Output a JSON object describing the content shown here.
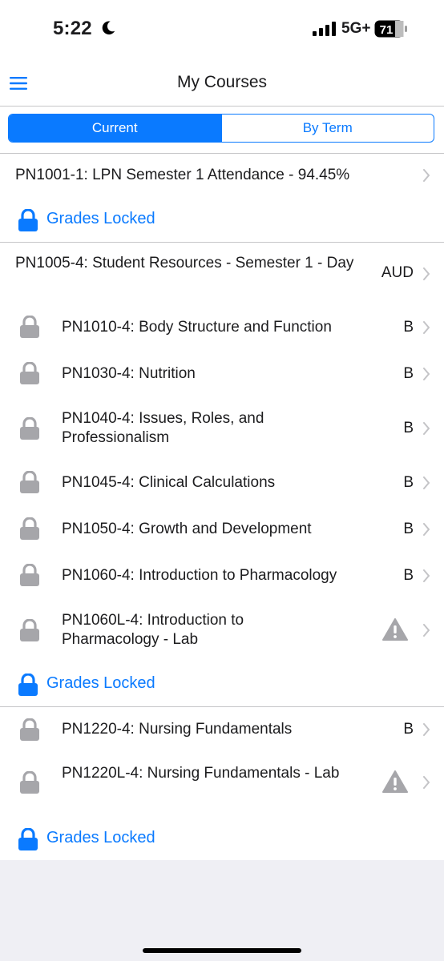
{
  "status": {
    "time": "5:22",
    "network": "5G+",
    "battery": "71"
  },
  "nav": {
    "title": "My Courses"
  },
  "segments": [
    {
      "label": "Current",
      "active": true
    },
    {
      "label": "By Term",
      "active": false
    }
  ],
  "groups": [
    {
      "header": {
        "title": "PN1001-1: LPN Semester 1 Attendance - 94.45%",
        "grade": ""
      },
      "courses": [],
      "locked_label": "Grades Locked"
    },
    {
      "header": {
        "title": "PN1005-4: Student Resources - Semester 1 - Day",
        "grade": "AUD"
      },
      "courses": [
        {
          "title": "PN1010-4: Body Structure and Function",
          "grade": "B",
          "warning": false
        },
        {
          "title": "PN1030-4: Nutrition",
          "grade": "B",
          "warning": false
        },
        {
          "title": "PN1040-4: Issues, Roles, and Professionalism",
          "grade": "B",
          "warning": false
        },
        {
          "title": "PN1045-4: Clinical Calculations",
          "grade": "B",
          "warning": false
        },
        {
          "title": "PN1050-4: Growth and Development",
          "grade": "B",
          "warning": false
        },
        {
          "title": "PN1060-4: Introduction to Pharmacology",
          "grade": "B",
          "warning": false
        },
        {
          "title": "PN1060L-4: Introduction to Pharmacology - Lab",
          "grade": "",
          "warning": true
        }
      ],
      "locked_label": "Grades Locked"
    },
    {
      "header": null,
      "courses": [
        {
          "title": "PN1220-4: Nursing Fundamentals",
          "grade": "B",
          "warning": false
        },
        {
          "title": "PN1220L-4: Nursing Fundamentals - Lab",
          "grade": "",
          "warning": true
        }
      ],
      "locked_label": "Grades Locked"
    }
  ],
  "icons": {
    "menu": "hamburger-icon",
    "lock": "lock-icon",
    "warning": "warning-icon",
    "chevron": "chevron-right-icon"
  },
  "colors": {
    "accent": "#0a7aff",
    "gray_icon": "#a6a6aa",
    "separator": "#c6c6c8"
  }
}
